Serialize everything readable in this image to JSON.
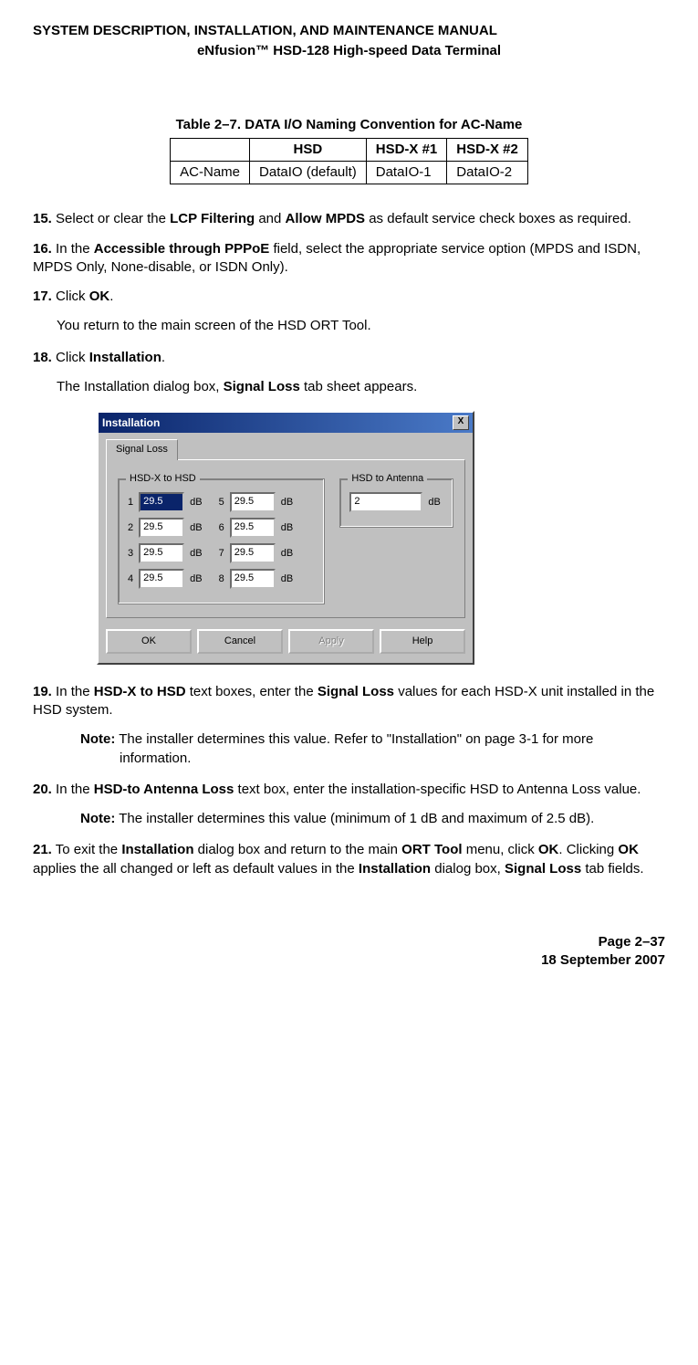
{
  "header": {
    "title": "SYSTEM DESCRIPTION, INSTALLATION, AND MAINTENANCE MANUAL",
    "subtitle": "eNfusion™ HSD-128 High-speed Data Terminal"
  },
  "table": {
    "caption": "Table 2–7. DATA I/O Naming Convention for AC-Name",
    "headers": [
      "",
      "HSD",
      "HSD-X #1",
      "HSD-X #2"
    ],
    "row": [
      "AC-Name",
      "DataIO (default)",
      "DataIO-1",
      "DataIO-2"
    ]
  },
  "steps": {
    "s15_num": "15.",
    "s15_a": "Select or clear the ",
    "s15_b1": "LCP Filtering",
    "s15_c": " and ",
    "s15_b2": "Allow MPDS",
    "s15_d": " as default service check boxes as required.",
    "s16_num": "16.",
    "s16_a": "In the ",
    "s16_b": "Accessible through PPPoE",
    "s16_c": " field, select the appropriate service option (MPDS and ISDN, MPDS Only, None-disable, or ISDN Only).",
    "s17_num": "17.",
    "s17_a": "Click ",
    "s17_b": "OK",
    "s17_c": ".",
    "s17_sub": "You return to the main screen of the HSD ORT Tool.",
    "s18_num": "18.",
    "s18_a": "Click ",
    "s18_b": "Installation",
    "s18_c": ".",
    "s18_sub_a": "The Installation dialog box, ",
    "s18_sub_b": "Signal Loss",
    "s18_sub_c": " tab sheet appears.",
    "s19_num": "19.",
    "s19_a": "In the ",
    "s19_b": "HSD-X to HSD",
    "s19_c": " text boxes, enter the ",
    "s19_d": "Signal Loss",
    "s19_e": " values for each HSD-X unit installed in the HSD system.",
    "s19_note_label": "Note:",
    "s19_note": " The installer determines this value. Refer to \"Installation\" on page 3-1 for more information.",
    "s20_num": "20.",
    "s20_a": "In the ",
    "s20_b": "HSD-to Antenna Loss",
    "s20_c": " text box, enter the installation-specific HSD to Antenna Loss value.",
    "s20_note_label": "Note:",
    "s20_note": " The installer determines this value (minimum of 1 dB and maximum of 2.5 dB).",
    "s21_num": "21.",
    "s21_a": "To exit the ",
    "s21_b": "Installation",
    "s21_c": " dialog box and return to the main ",
    "s21_d": "ORT Tool",
    "s21_e": " menu, click ",
    "s21_f": "OK",
    "s21_g": ". Clicking ",
    "s21_h": "OK",
    "s21_i": " applies the all changed or left as default values in the ",
    "s21_j": "Installation",
    "s21_k": " dialog box, ",
    "s21_l": "Signal Loss",
    "s21_m": " tab fields."
  },
  "dialog": {
    "title": "Installation",
    "close": "X",
    "tab": "Signal Loss",
    "group_hsdx": "HSD-X to HSD",
    "group_ant": "HSD to Antenna",
    "db": "dB",
    "labels": [
      "1",
      "2",
      "3",
      "4",
      "5",
      "6",
      "7",
      "8"
    ],
    "values": [
      "29.5",
      "29.5",
      "29.5",
      "29.5",
      "29.5",
      "29.5",
      "29.5",
      "29.5"
    ],
    "ant_value": "2",
    "btn_ok": "OK",
    "btn_cancel": "Cancel",
    "btn_apply": "Apply",
    "btn_help": "Help"
  },
  "footer": {
    "page": "Page 2–37",
    "date": "18 September 2007"
  }
}
